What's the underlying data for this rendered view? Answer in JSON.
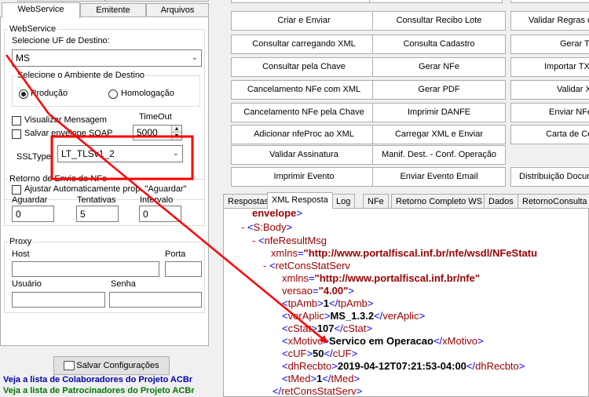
{
  "left": {
    "tabs": [
      {
        "label": "WebService"
      },
      {
        "label": "Emitente"
      },
      {
        "label": "Arquivos"
      }
    ],
    "webservice": {
      "group_title": "WebService",
      "uf_label": "Selecione UF de Destino:",
      "uf_value": "MS",
      "ambiente_title": "Selecione o Ambiente de Destino",
      "producao": "Produção",
      "homologacao": "Homologação",
      "visualizar": "Visualizar Mensagem",
      "salvar": "Salvar envelope SOAP",
      "timeout_label": "TimeOut",
      "timeout_value": "5000",
      "ssltype_label": "SSLType",
      "ssltype_value": "LT_TLSv1_2"
    },
    "retorno": {
      "title": "Retorno de Envio de NFe",
      "ajustar": "Ajustar Automaticamente prop. \"Aguardar\"",
      "aguardar_label": "Aguardar",
      "aguardar_value": "0",
      "tentativas_label": "Tentativas",
      "tentativas_value": "5",
      "intervalo_label": "Intervalo",
      "intervalo_value": "0"
    },
    "proxy": {
      "title": "Proxy",
      "host": "Host",
      "porta": "Porta",
      "usuario": "Usuário",
      "senha": "Senha"
    },
    "salvar_config": "Salvar Configurações",
    "link1": "Veja a lista de Colaboradores do Projeto ACBr",
    "link2": "Veja a lista de Patrocinadores do Projeto ACBr"
  },
  "buttons": {
    "col1": [
      "Criar e Enviar",
      "Consultar carregando XML",
      "Consultar pela Chave",
      "Cancelamento NFe com XML",
      "Cancelamento NFe pela Chave",
      "Adicionar nfeProc ao XML",
      "Validar Assinatura",
      "Imprimir Evento"
    ],
    "col2": [
      "Consultar Recibo Lote",
      "Consulta Cadastro",
      "Gerar NFe",
      "Gerar PDF",
      "Imprimir DANFE",
      "Carregar XML e Enviar",
      "Manif. Dest. - Conf. Operação",
      "Enviar Evento Email"
    ],
    "col3": [
      "Validar Regras de",
      "Gerar TX",
      "Importar TXT",
      "Validar X",
      "Enviar NFe",
      "Carta de Co",
      "Distribuição Docum"
    ]
  },
  "result_tabs": [
    "Respostas",
    "XML Resposta",
    "Log",
    "NFe",
    "Retorno Completo WS",
    "Dados",
    "RetornoConsulta N"
  ],
  "xml": {
    "envelope": "envelope",
    "body": "S:Body",
    "nfeResultMsg": "nfeResultMsg",
    "xmlns_attr": "xmlns",
    "ns_wsdl": "\"http://www.portalfiscal.inf.br/nfe/wsdl/NFeStatu",
    "retConsStatServ": "retConsStatServ",
    "ns_nfe": "\"http://www.portalfiscal.inf.br/nfe\"",
    "versao_attr": "versao",
    "versao_val": "\"4.00\"",
    "tpAmb": "tpAmb",
    "tpAmb_val": "1",
    "verAplic": "verAplic",
    "verAplic_val": "MS_1.3.2",
    "cStat": "cStat",
    "cStat_val": "107",
    "xMotivo": "xMotivo",
    "xMotivo_val": "Servico em Operacao",
    "cUF": "cUF",
    "cUF_val": "50",
    "dhRecbto": "dhRecbto",
    "dhRecbto_val": "2019-04-12T07:21:53-04:00",
    "tMed": "tMed",
    "tMed_val": "1"
  },
  "colors": {
    "annotation_red": "#ff0000",
    "link_blue": "#0000aa",
    "link_green": "#007700",
    "xml_tag": "#990000",
    "xml_bracket": "#0000ff"
  }
}
